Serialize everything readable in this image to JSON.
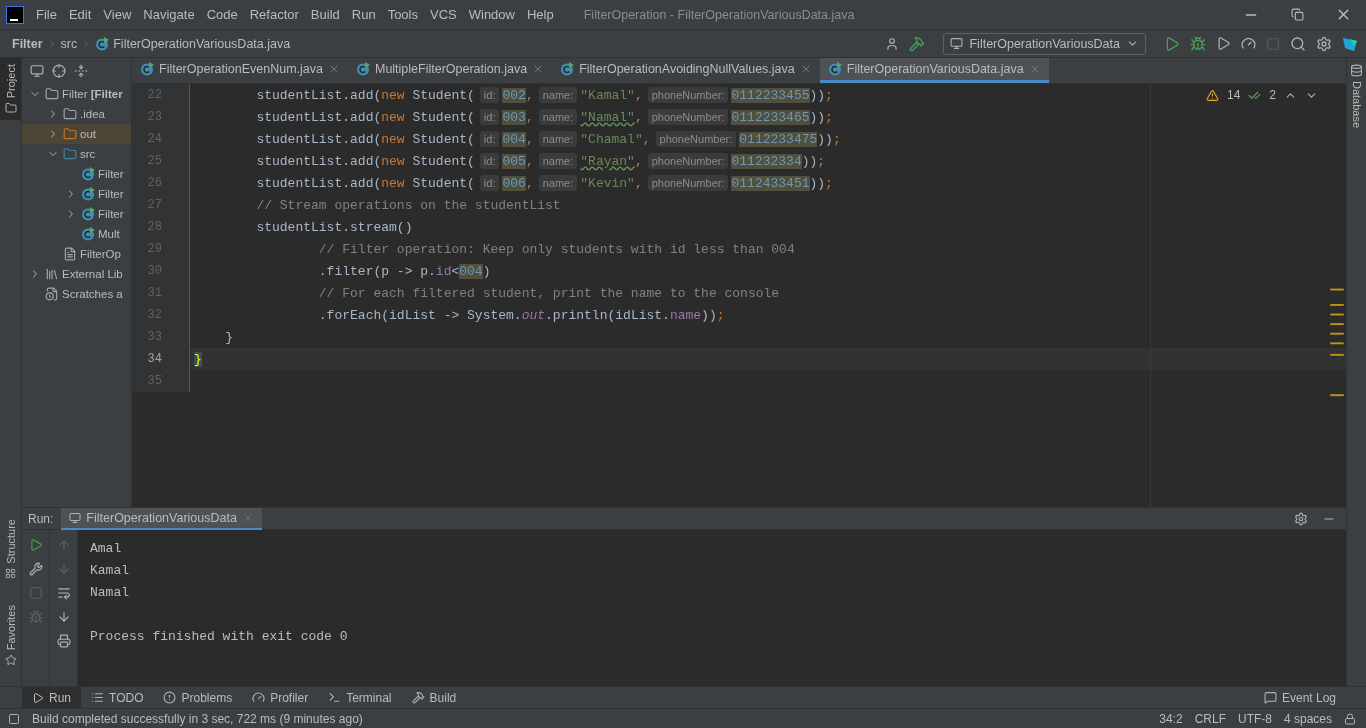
{
  "window": {
    "title": "FilterOperation - FilterOperationVariousData.java"
  },
  "menu": [
    "File",
    "Edit",
    "View",
    "Navigate",
    "Code",
    "Refactor",
    "Build",
    "Run",
    "Tools",
    "VCS",
    "Window",
    "Help"
  ],
  "breadcrumbs": [
    "Filter",
    "src",
    "FilterOperationVariousData.java"
  ],
  "toolbar": {
    "run_config": "FilterOperationVariousData"
  },
  "left_stripe": [
    {
      "label": "Project",
      "selected": true
    },
    {
      "label": "Structure",
      "selected": false
    },
    {
      "label": "Favorites",
      "selected": false
    }
  ],
  "right_stripe": [
    {
      "label": "Database"
    }
  ],
  "project_tree": [
    {
      "label": "Filter **[Filter**",
      "kind": "module",
      "expanded": true,
      "selected": false,
      "children": [
        {
          "label": ".idea",
          "kind": "folder",
          "expanded": false,
          "selected": false
        },
        {
          "label": "out",
          "kind": "folder-excluded",
          "expanded": false,
          "selected": true
        },
        {
          "label": "src",
          "kind": "folder-source",
          "expanded": true,
          "selected": false,
          "children": [
            {
              "label": "Filter",
              "kind": "class",
              "selected": false
            },
            {
              "label": "Filter",
              "kind": "class",
              "expanded": false,
              "selected": false
            },
            {
              "label": "Filter",
              "kind": "class",
              "expanded": false,
              "selected": false
            },
            {
              "label": "Mult",
              "kind": "class",
              "selected": false
            }
          ]
        },
        {
          "label": "FilterOp",
          "kind": "file",
          "selected": false
        }
      ]
    },
    {
      "label": "External Lib",
      "kind": "library",
      "expanded": false,
      "selected": false
    },
    {
      "label": "Scratches a",
      "kind": "scratches",
      "selected": false
    }
  ],
  "editor_tabs": [
    {
      "label": "FilterOperationEvenNum.java",
      "selected": false
    },
    {
      "label": "MultipleFilterOperation.java",
      "selected": false
    },
    {
      "label": "FilterOperationAvoidingNullValues.java",
      "selected": false
    },
    {
      "label": "FilterOperationVariousData.java",
      "selected": true
    }
  ],
  "editor": {
    "inspections": {
      "warnings": "14",
      "passed": "2"
    },
    "lines": [
      {
        "number": "22",
        "current": false,
        "tokens": [
          {
            "kind": "plain",
            "text": "        studentList.add("
          },
          {
            "kind": "keyword",
            "text": "new"
          },
          {
            "kind": "plain",
            "text": " Student("
          },
          {
            "kind": "hint",
            "text": "id:"
          },
          {
            "kind": "number",
            "text": "002",
            "highlighted": true
          },
          {
            "kind": "punct",
            "text": ","
          },
          {
            "kind": "hint",
            "text": "name:"
          },
          {
            "kind": "string",
            "text": "\"Kamal\"",
            "typo": false
          },
          {
            "kind": "punct",
            "text": ","
          },
          {
            "kind": "hint",
            "text": "phoneNumber:"
          },
          {
            "kind": "number",
            "text": "0112233455",
            "highlighted": true
          },
          {
            "kind": "plain",
            "text": "))"
          },
          {
            "kind": "punct",
            "text": ";"
          }
        ]
      },
      {
        "number": "23",
        "current": false,
        "tokens": [
          {
            "kind": "plain",
            "text": "        studentList.add("
          },
          {
            "kind": "keyword",
            "text": "new"
          },
          {
            "kind": "plain",
            "text": " Student("
          },
          {
            "kind": "hint",
            "text": "id:"
          },
          {
            "kind": "number",
            "text": "003",
            "highlighted": true
          },
          {
            "kind": "punct",
            "text": ","
          },
          {
            "kind": "hint",
            "text": "name:"
          },
          {
            "kind": "string",
            "text": "\"Namal\"",
            "typo": true
          },
          {
            "kind": "punct",
            "text": ","
          },
          {
            "kind": "hint",
            "text": "phoneNumber:"
          },
          {
            "kind": "number",
            "text": "0112233465",
            "highlighted": true
          },
          {
            "kind": "plain",
            "text": "))"
          },
          {
            "kind": "punct",
            "text": ";"
          }
        ]
      },
      {
        "number": "24",
        "current": false,
        "tokens": [
          {
            "kind": "plain",
            "text": "        studentList.add("
          },
          {
            "kind": "keyword",
            "text": "new"
          },
          {
            "kind": "plain",
            "text": " Student("
          },
          {
            "kind": "hint",
            "text": "id:"
          },
          {
            "kind": "number",
            "text": "004",
            "highlighted": true
          },
          {
            "kind": "punct",
            "text": ","
          },
          {
            "kind": "hint",
            "text": "name:"
          },
          {
            "kind": "string",
            "text": "\"Chamal\"",
            "typo": false
          },
          {
            "kind": "punct",
            "text": ","
          },
          {
            "kind": "hint",
            "text": "phoneNumber:"
          },
          {
            "kind": "number",
            "text": "0112233475",
            "highlighted": true
          },
          {
            "kind": "plain",
            "text": "))"
          },
          {
            "kind": "punct",
            "text": ";"
          }
        ]
      },
      {
        "number": "25",
        "current": false,
        "tokens": [
          {
            "kind": "plain",
            "text": "        studentList.add("
          },
          {
            "kind": "keyword",
            "text": "new"
          },
          {
            "kind": "plain",
            "text": " Student("
          },
          {
            "kind": "hint",
            "text": "id:"
          },
          {
            "kind": "number",
            "text": "005",
            "highlighted": true
          },
          {
            "kind": "punct",
            "text": ","
          },
          {
            "kind": "hint",
            "text": "name:"
          },
          {
            "kind": "string",
            "text": "\"Rayan\"",
            "typo": true
          },
          {
            "kind": "punct",
            "text": ","
          },
          {
            "kind": "hint",
            "text": "phoneNumber:"
          },
          {
            "kind": "number",
            "text": "011232334",
            "highlighted": true
          },
          {
            "kind": "plain",
            "text": "))"
          },
          {
            "kind": "punct",
            "text": ";"
          }
        ]
      },
      {
        "number": "26",
        "current": false,
        "tokens": [
          {
            "kind": "plain",
            "text": "        studentList.add("
          },
          {
            "kind": "keyword",
            "text": "new"
          },
          {
            "kind": "plain",
            "text": " Student("
          },
          {
            "kind": "hint",
            "text": "id:"
          },
          {
            "kind": "number",
            "text": "006",
            "highlighted": true
          },
          {
            "kind": "punct",
            "text": ","
          },
          {
            "kind": "hint",
            "text": "name:"
          },
          {
            "kind": "string",
            "text": "\"Kevin\"",
            "typo": false
          },
          {
            "kind": "punct",
            "text": ","
          },
          {
            "kind": "hint",
            "text": "phoneNumber:"
          },
          {
            "kind": "number",
            "text": "0112433451",
            "highlighted": true
          },
          {
            "kind": "plain",
            "text": "))"
          },
          {
            "kind": "punct",
            "text": ";"
          }
        ]
      },
      {
        "number": "27",
        "current": false,
        "tokens": [
          {
            "kind": "comment",
            "text": "        // Stream operations on the studentList"
          }
        ]
      },
      {
        "number": "28",
        "current": false,
        "tokens": [
          {
            "kind": "plain",
            "text": "        studentList.stream()"
          }
        ]
      },
      {
        "number": "29",
        "current": false,
        "tokens": [
          {
            "kind": "comment",
            "text": "                // Filter operation: Keep only students with id less than 004"
          }
        ]
      },
      {
        "number": "30",
        "current": false,
        "tokens": [
          {
            "kind": "plain",
            "text": "                .filter(p -> p."
          },
          {
            "kind": "field",
            "text": "id"
          },
          {
            "kind": "plain",
            "text": "<"
          },
          {
            "kind": "number",
            "text": "004",
            "highlighted": true
          },
          {
            "kind": "plain",
            "text": ")"
          }
        ]
      },
      {
        "number": "31",
        "current": false,
        "tokens": [
          {
            "kind": "comment",
            "text": "                // For each filtered student, print the name to the console"
          }
        ]
      },
      {
        "number": "32",
        "current": false,
        "tokens": [
          {
            "kind": "plain",
            "text": "                .forEach(idList -> System."
          },
          {
            "kind": "static",
            "text": "out"
          },
          {
            "kind": "plain",
            "text": ".println(idList."
          },
          {
            "kind": "field",
            "text": "name"
          },
          {
            "kind": "plain",
            "text": "))"
          },
          {
            "kind": "punct",
            "text": ";"
          }
        ]
      },
      {
        "number": "33",
        "current": false,
        "tokens": [
          {
            "kind": "plain",
            "text": "    }"
          }
        ]
      },
      {
        "number": "34",
        "current": true,
        "tokens": [
          {
            "kind": "brace",
            "text": "}"
          }
        ]
      },
      {
        "number": "35",
        "current": false
      }
    ]
  },
  "run_panel": {
    "label": "Run:",
    "tab": "FilterOperationVariousData",
    "output": [
      {
        "kind": "out",
        "text": "Amal"
      },
      {
        "kind": "out",
        "text": "Kamal"
      },
      {
        "kind": "out",
        "text": "Namal"
      },
      {
        "kind": "exit",
        "text": "Process finished with exit code 0"
      }
    ]
  },
  "tool_tabs": [
    {
      "label": "Run",
      "selected": true
    },
    {
      "label": "TODO",
      "selected": false
    },
    {
      "label": "Problems",
      "selected": false
    },
    {
      "label": "Profiler",
      "selected": false
    },
    {
      "label": "Terminal",
      "selected": false
    },
    {
      "label": "Build",
      "selected": false
    }
  ],
  "event_log": "Event Log",
  "status_bar": {
    "message": "Build completed successfully in 3 sec, 722 ms (9 minutes ago)",
    "items": [
      "34:2",
      "CRLF",
      "UTF-8",
      "4 spaces"
    ]
  }
}
